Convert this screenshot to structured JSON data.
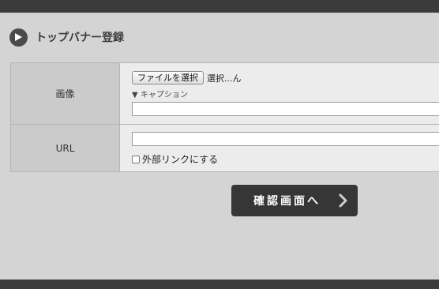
{
  "section": {
    "title": "トップバナー登録",
    "icon": "play-circle-icon"
  },
  "form": {
    "image_row": {
      "label": "画像",
      "file_button_label": "ファイルを選択",
      "file_status": "選択...ん",
      "caption_toggle": "▼ キャプション",
      "caption_value": ""
    },
    "url_row": {
      "label": "URL",
      "url_value": "",
      "external_link_label": "外部リンクにする",
      "external_link_checked": false
    }
  },
  "submit": {
    "label": "確認画面へ",
    "icon": "chevron-right-icon"
  },
  "colors": {
    "frame": "#3b3b3b",
    "panel": "#d4d4d4",
    "label_cell": "#cbcbcb",
    "value_cell": "#ececec",
    "button": "#363636"
  }
}
